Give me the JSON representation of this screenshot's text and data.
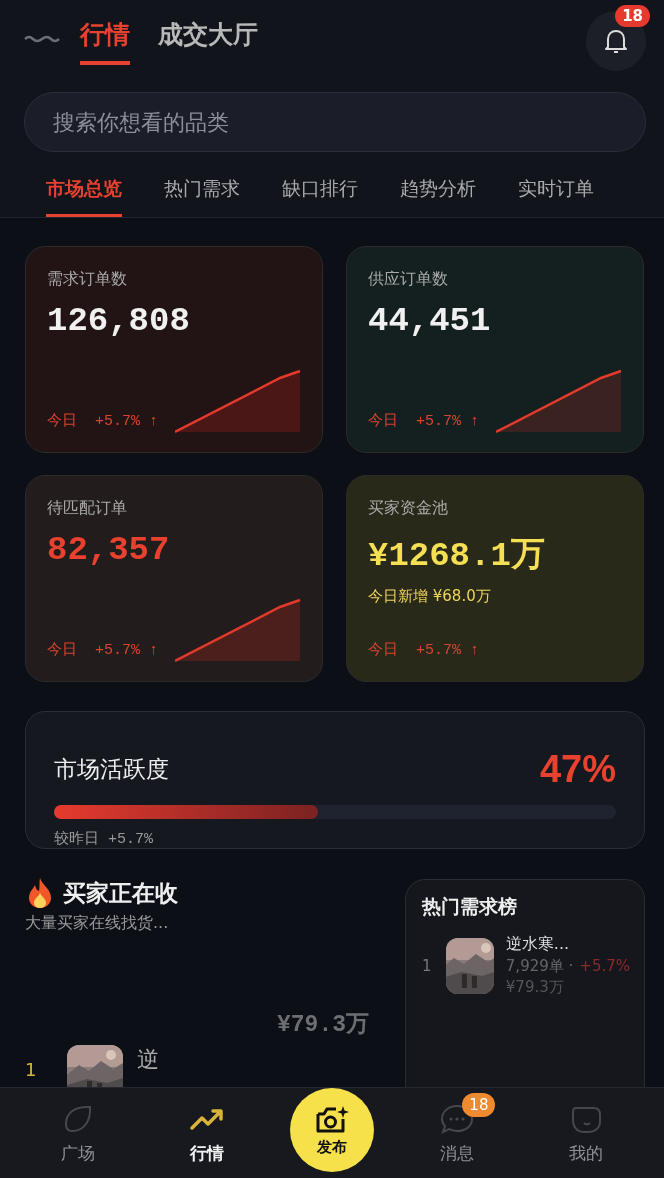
{
  "header": {
    "tabs": [
      {
        "label": "行情",
        "selected": true
      },
      {
        "label": "成交大厅",
        "selected": false
      }
    ],
    "notification_badge": "18"
  },
  "search": {
    "placeholder": "搜索你想看的品类"
  },
  "subtabs": [
    {
      "label": "市场总览",
      "selected": true
    },
    {
      "label": "热门需求",
      "selected": false
    },
    {
      "label": "缺口排行",
      "selected": false
    },
    {
      "label": "趋势分析",
      "selected": false
    },
    {
      "label": "实时订单",
      "selected": false
    }
  ],
  "stats": [
    {
      "kind": "count",
      "color": "#221315",
      "title": "需求订单数",
      "value": "126,808",
      "today": "今日",
      "change": "+5.7% ↑"
    },
    {
      "kind": "count",
      "color": "#13201f",
      "title": "供应订单数",
      "value": "44,451",
      "today": "今日",
      "change": "+5.7% ↑"
    },
    {
      "kind": "alert",
      "color": "#231c1c",
      "title": "待匹配订单",
      "value": "82,357",
      "today": "今日",
      "change": "+5.7% ↑"
    },
    {
      "kind": "money",
      "color": "#29291a",
      "title": "买家资金池",
      "value": "¥1268.1万",
      "subline": "今日新增 ¥68.0万",
      "today": "今日",
      "change": "+5.7% ↑"
    }
  ],
  "activity": {
    "title": "市场活跃度",
    "reading": "47%",
    "level": 0.47,
    "compare": "较昨日 +5.7%"
  },
  "buyers": {
    "title": "买家正在收",
    "subtitle": "大量买家在线找货...",
    "rows": [
      {
        "price": "¥79.3万",
        "rank": "1",
        "name": "逆"
      }
    ]
  },
  "hot_list": {
    "title": "热门需求榜",
    "items": [
      {
        "rank": "1",
        "name": "逆水寒...",
        "orders": "7,929单 ·",
        "change": "+5.7%",
        "price": "¥79.3万"
      }
    ]
  },
  "nav": [
    {
      "kind": "plaza",
      "label": "广场",
      "selected": false
    },
    {
      "kind": "market",
      "label": "行情",
      "selected": true
    },
    {
      "kind": "publish",
      "label": "发布"
    },
    {
      "kind": "messages",
      "label": "消息",
      "selected": false,
      "badge": "18"
    },
    {
      "kind": "me",
      "label": "我的",
      "selected": false
    }
  ]
}
